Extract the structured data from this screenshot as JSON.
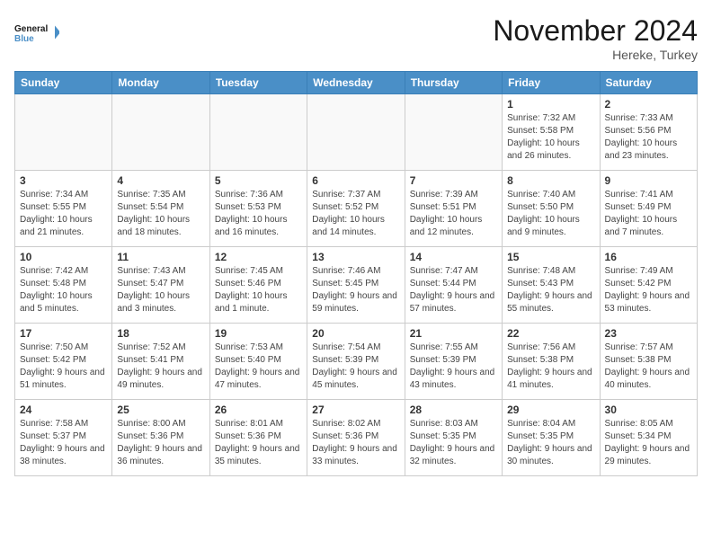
{
  "header": {
    "logo_line1": "General",
    "logo_line2": "Blue",
    "month": "November 2024",
    "location": "Hereke, Turkey"
  },
  "weekdays": [
    "Sunday",
    "Monday",
    "Tuesday",
    "Wednesday",
    "Thursday",
    "Friday",
    "Saturday"
  ],
  "weeks": [
    [
      {
        "day": "",
        "info": ""
      },
      {
        "day": "",
        "info": ""
      },
      {
        "day": "",
        "info": ""
      },
      {
        "day": "",
        "info": ""
      },
      {
        "day": "",
        "info": ""
      },
      {
        "day": "1",
        "info": "Sunrise: 7:32 AM\nSunset: 5:58 PM\nDaylight: 10 hours and 26 minutes."
      },
      {
        "day": "2",
        "info": "Sunrise: 7:33 AM\nSunset: 5:56 PM\nDaylight: 10 hours and 23 minutes."
      }
    ],
    [
      {
        "day": "3",
        "info": "Sunrise: 7:34 AM\nSunset: 5:55 PM\nDaylight: 10 hours and 21 minutes."
      },
      {
        "day": "4",
        "info": "Sunrise: 7:35 AM\nSunset: 5:54 PM\nDaylight: 10 hours and 18 minutes."
      },
      {
        "day": "5",
        "info": "Sunrise: 7:36 AM\nSunset: 5:53 PM\nDaylight: 10 hours and 16 minutes."
      },
      {
        "day": "6",
        "info": "Sunrise: 7:37 AM\nSunset: 5:52 PM\nDaylight: 10 hours and 14 minutes."
      },
      {
        "day": "7",
        "info": "Sunrise: 7:39 AM\nSunset: 5:51 PM\nDaylight: 10 hours and 12 minutes."
      },
      {
        "day": "8",
        "info": "Sunrise: 7:40 AM\nSunset: 5:50 PM\nDaylight: 10 hours and 9 minutes."
      },
      {
        "day": "9",
        "info": "Sunrise: 7:41 AM\nSunset: 5:49 PM\nDaylight: 10 hours and 7 minutes."
      }
    ],
    [
      {
        "day": "10",
        "info": "Sunrise: 7:42 AM\nSunset: 5:48 PM\nDaylight: 10 hours and 5 minutes."
      },
      {
        "day": "11",
        "info": "Sunrise: 7:43 AM\nSunset: 5:47 PM\nDaylight: 10 hours and 3 minutes."
      },
      {
        "day": "12",
        "info": "Sunrise: 7:45 AM\nSunset: 5:46 PM\nDaylight: 10 hours and 1 minute."
      },
      {
        "day": "13",
        "info": "Sunrise: 7:46 AM\nSunset: 5:45 PM\nDaylight: 9 hours and 59 minutes."
      },
      {
        "day": "14",
        "info": "Sunrise: 7:47 AM\nSunset: 5:44 PM\nDaylight: 9 hours and 57 minutes."
      },
      {
        "day": "15",
        "info": "Sunrise: 7:48 AM\nSunset: 5:43 PM\nDaylight: 9 hours and 55 minutes."
      },
      {
        "day": "16",
        "info": "Sunrise: 7:49 AM\nSunset: 5:42 PM\nDaylight: 9 hours and 53 minutes."
      }
    ],
    [
      {
        "day": "17",
        "info": "Sunrise: 7:50 AM\nSunset: 5:42 PM\nDaylight: 9 hours and 51 minutes."
      },
      {
        "day": "18",
        "info": "Sunrise: 7:52 AM\nSunset: 5:41 PM\nDaylight: 9 hours and 49 minutes."
      },
      {
        "day": "19",
        "info": "Sunrise: 7:53 AM\nSunset: 5:40 PM\nDaylight: 9 hours and 47 minutes."
      },
      {
        "day": "20",
        "info": "Sunrise: 7:54 AM\nSunset: 5:39 PM\nDaylight: 9 hours and 45 minutes."
      },
      {
        "day": "21",
        "info": "Sunrise: 7:55 AM\nSunset: 5:39 PM\nDaylight: 9 hours and 43 minutes."
      },
      {
        "day": "22",
        "info": "Sunrise: 7:56 AM\nSunset: 5:38 PM\nDaylight: 9 hours and 41 minutes."
      },
      {
        "day": "23",
        "info": "Sunrise: 7:57 AM\nSunset: 5:38 PM\nDaylight: 9 hours and 40 minutes."
      }
    ],
    [
      {
        "day": "24",
        "info": "Sunrise: 7:58 AM\nSunset: 5:37 PM\nDaylight: 9 hours and 38 minutes."
      },
      {
        "day": "25",
        "info": "Sunrise: 8:00 AM\nSunset: 5:36 PM\nDaylight: 9 hours and 36 minutes."
      },
      {
        "day": "26",
        "info": "Sunrise: 8:01 AM\nSunset: 5:36 PM\nDaylight: 9 hours and 35 minutes."
      },
      {
        "day": "27",
        "info": "Sunrise: 8:02 AM\nSunset: 5:36 PM\nDaylight: 9 hours and 33 minutes."
      },
      {
        "day": "28",
        "info": "Sunrise: 8:03 AM\nSunset: 5:35 PM\nDaylight: 9 hours and 32 minutes."
      },
      {
        "day": "29",
        "info": "Sunrise: 8:04 AM\nSunset: 5:35 PM\nDaylight: 9 hours and 30 minutes."
      },
      {
        "day": "30",
        "info": "Sunrise: 8:05 AM\nSunset: 5:34 PM\nDaylight: 9 hours and 29 minutes."
      }
    ]
  ]
}
